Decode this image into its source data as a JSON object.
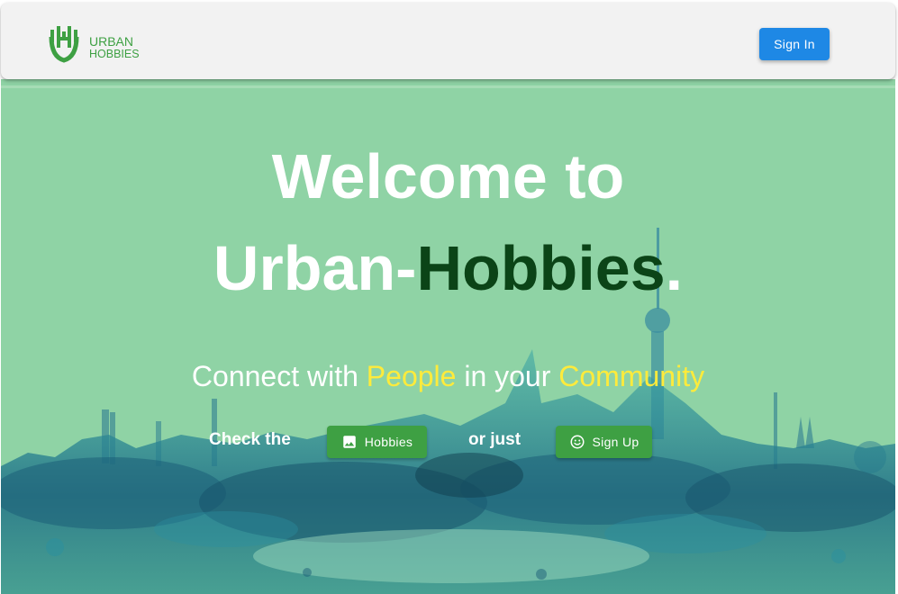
{
  "header": {
    "logo": {
      "line1": "URBAN",
      "line2": "HOBBIES",
      "icon": "urban-hobbies-logo-icon"
    },
    "signin_label": "Sign In"
  },
  "hero": {
    "title_line1": "Welcome to",
    "title_line2_prefix": "Urban-",
    "title_line2_accent": "Hobbies",
    "title_line2_suffix": ".",
    "subtitle": {
      "part1": "Connect with ",
      "highlight1": "People",
      "part2": " in your ",
      "highlight2": "Community"
    },
    "cta": {
      "check_text": "Check the",
      "hobbies_label": "Hobbies",
      "hobbies_icon": "image-icon",
      "or_text": "or just",
      "signup_label": "Sign Up",
      "signup_icon": "smiley-icon"
    },
    "background_icon": "city-skyline-watercolor"
  },
  "colors": {
    "appbar_bg": "#f2f2f2",
    "signin_blue": "#1e88e5",
    "hero_bg": "#8fd3a5",
    "accent_dark_green": "#0b4417",
    "highlight_yellow": "#ffeb3b",
    "button_green": "#3ea043"
  }
}
